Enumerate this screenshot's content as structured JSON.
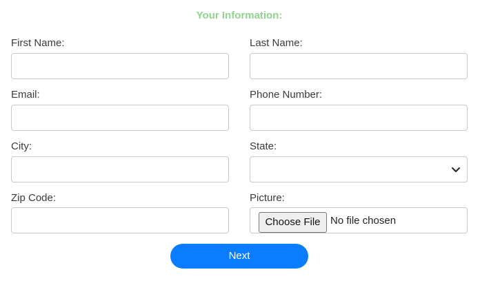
{
  "form": {
    "title": "Your Information:",
    "fields": {
      "first_name": {
        "label": "First Name:",
        "value": "",
        "placeholder": ""
      },
      "last_name": {
        "label": "Last Name:",
        "value": "",
        "placeholder": ""
      },
      "email": {
        "label": "Email:",
        "value": "",
        "placeholder": ""
      },
      "phone": {
        "label": "Phone Number:",
        "value": "",
        "placeholder": ""
      },
      "city": {
        "label": "City:",
        "value": "",
        "placeholder": ""
      },
      "state": {
        "label": "State:",
        "selected": ""
      },
      "zip": {
        "label": "Zip Code:",
        "value": "",
        "placeholder": ""
      },
      "picture": {
        "label": "Picture:",
        "button_label": "Choose File",
        "status": "No file chosen"
      }
    },
    "next_label": "Next"
  },
  "colors": {
    "title": "#8fd48f",
    "accent": "#0a7cff",
    "input_border": "#c9c9c9"
  },
  "icons": {
    "state_dropdown": "chevron-down-icon"
  }
}
